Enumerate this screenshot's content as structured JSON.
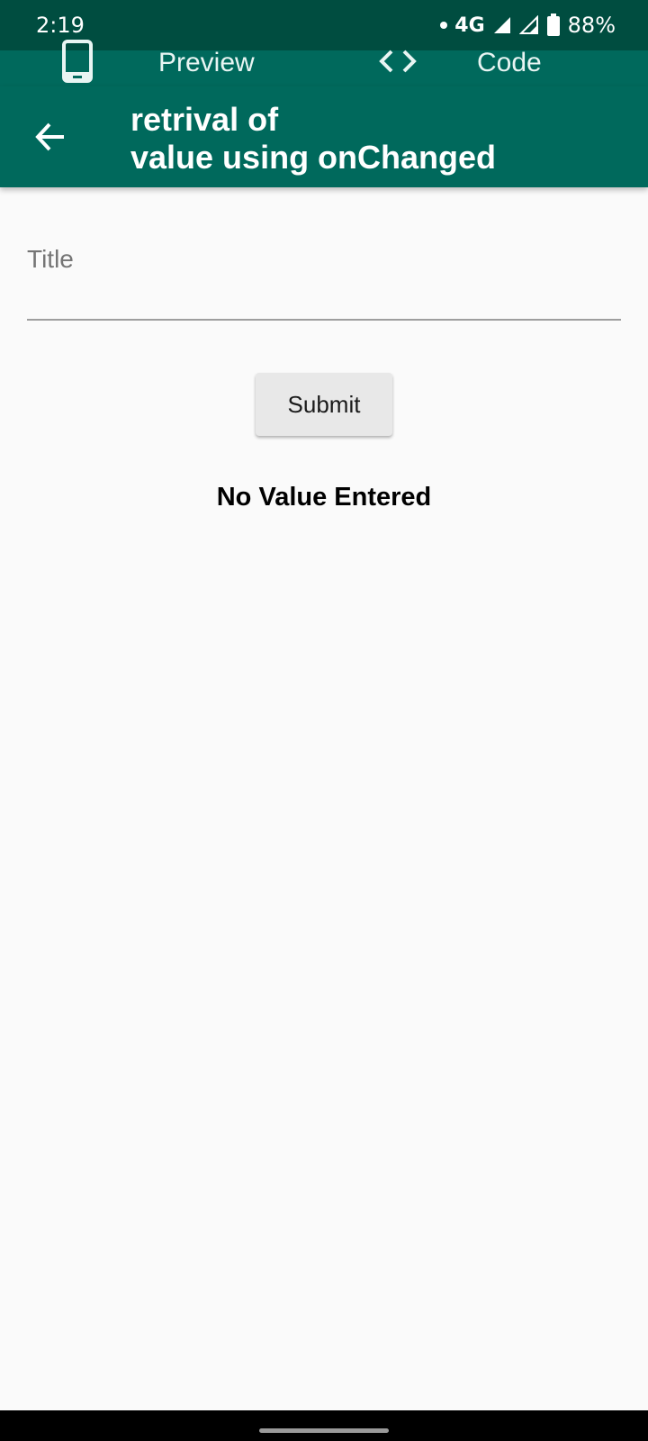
{
  "status_bar": {
    "time": "2:19",
    "network": "4G",
    "battery": "88%",
    "icons": [
      "signal-dot-icon",
      "signal-icon",
      "signal-icon",
      "battery-icon"
    ]
  },
  "tabs": [
    {
      "label": "Preview",
      "icon": "phone-icon"
    },
    {
      "label": "Code",
      "icon": "code-brackets-icon"
    }
  ],
  "app_bar": {
    "title": "retrival of\nvalue using onChanged",
    "back_icon": "arrow-back-icon"
  },
  "form": {
    "title_placeholder": "Title",
    "title_value": "",
    "submit_label": "Submit"
  },
  "result": {
    "text": "No Value Entered"
  },
  "colors": {
    "status_bar": "#004d40",
    "primary": "#00695c",
    "background": "#fafafa",
    "button": "#e8e8e8"
  }
}
